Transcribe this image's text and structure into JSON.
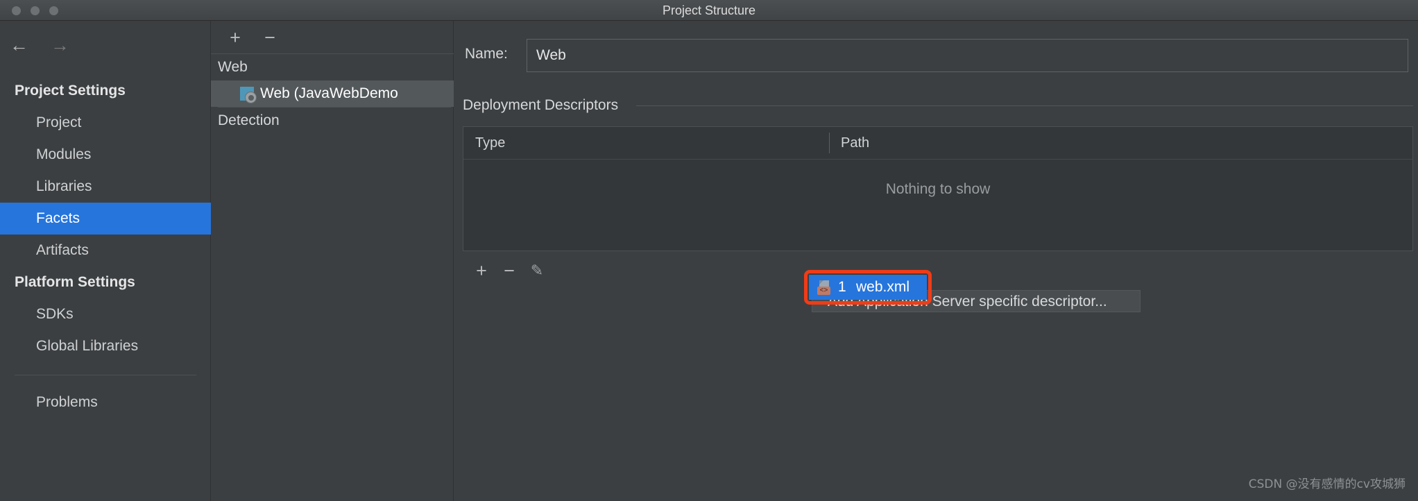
{
  "window": {
    "title": "Project Structure",
    "traffic_lights": [
      "close",
      "minimize",
      "zoom"
    ]
  },
  "nav": {
    "back_icon": "←",
    "forward_icon": "→"
  },
  "sidebar": {
    "groups": [
      {
        "label": "Project Settings",
        "type": "group"
      },
      {
        "label": "Project",
        "type": "item"
      },
      {
        "label": "Modules",
        "type": "item"
      },
      {
        "label": "Libraries",
        "type": "item"
      },
      {
        "label": "Facets",
        "type": "item",
        "selected": true
      },
      {
        "label": "Artifacts",
        "type": "item"
      },
      {
        "label": "Platform Settings",
        "type": "group"
      },
      {
        "label": "SDKs",
        "type": "item"
      },
      {
        "label": "Global Libraries",
        "type": "item"
      },
      {
        "label": "Problems",
        "type": "item"
      }
    ],
    "selected": "Facets",
    "selected_color": "#2675dc"
  },
  "facet_panel": {
    "toolbar": {
      "add_label": "+",
      "remove_label": "−"
    },
    "tree": [
      {
        "label": "Web",
        "level": 0
      },
      {
        "label": "Web (JavaWebDemo",
        "level": 1,
        "selected": true,
        "icon": "web-facet-icon"
      },
      {
        "label": "Detection",
        "level": 0
      }
    ]
  },
  "main": {
    "name_label": "Name:",
    "name_value": "Web",
    "name_placeholder": "",
    "section_title": "Deployment Descriptors",
    "table": {
      "columns": [
        "Type",
        "Path"
      ],
      "rows": [],
      "empty_text": "Nothing to show"
    },
    "table_toolbar": {
      "add_label": "+",
      "remove_label": "−",
      "edit_label": "✎"
    },
    "popup_menu": [
      {
        "label": "1  web.xml",
        "number": "1",
        "name": "web.xml",
        "selected": true,
        "icon": "xml-file-icon"
      },
      {
        "label": "Add Application Server specific descriptor...",
        "selected": false
      }
    ]
  },
  "annotation": {
    "highlight_color": "#f03c18"
  },
  "watermark": {
    "text": "CSDN @没有感情的cv攻城狮"
  }
}
